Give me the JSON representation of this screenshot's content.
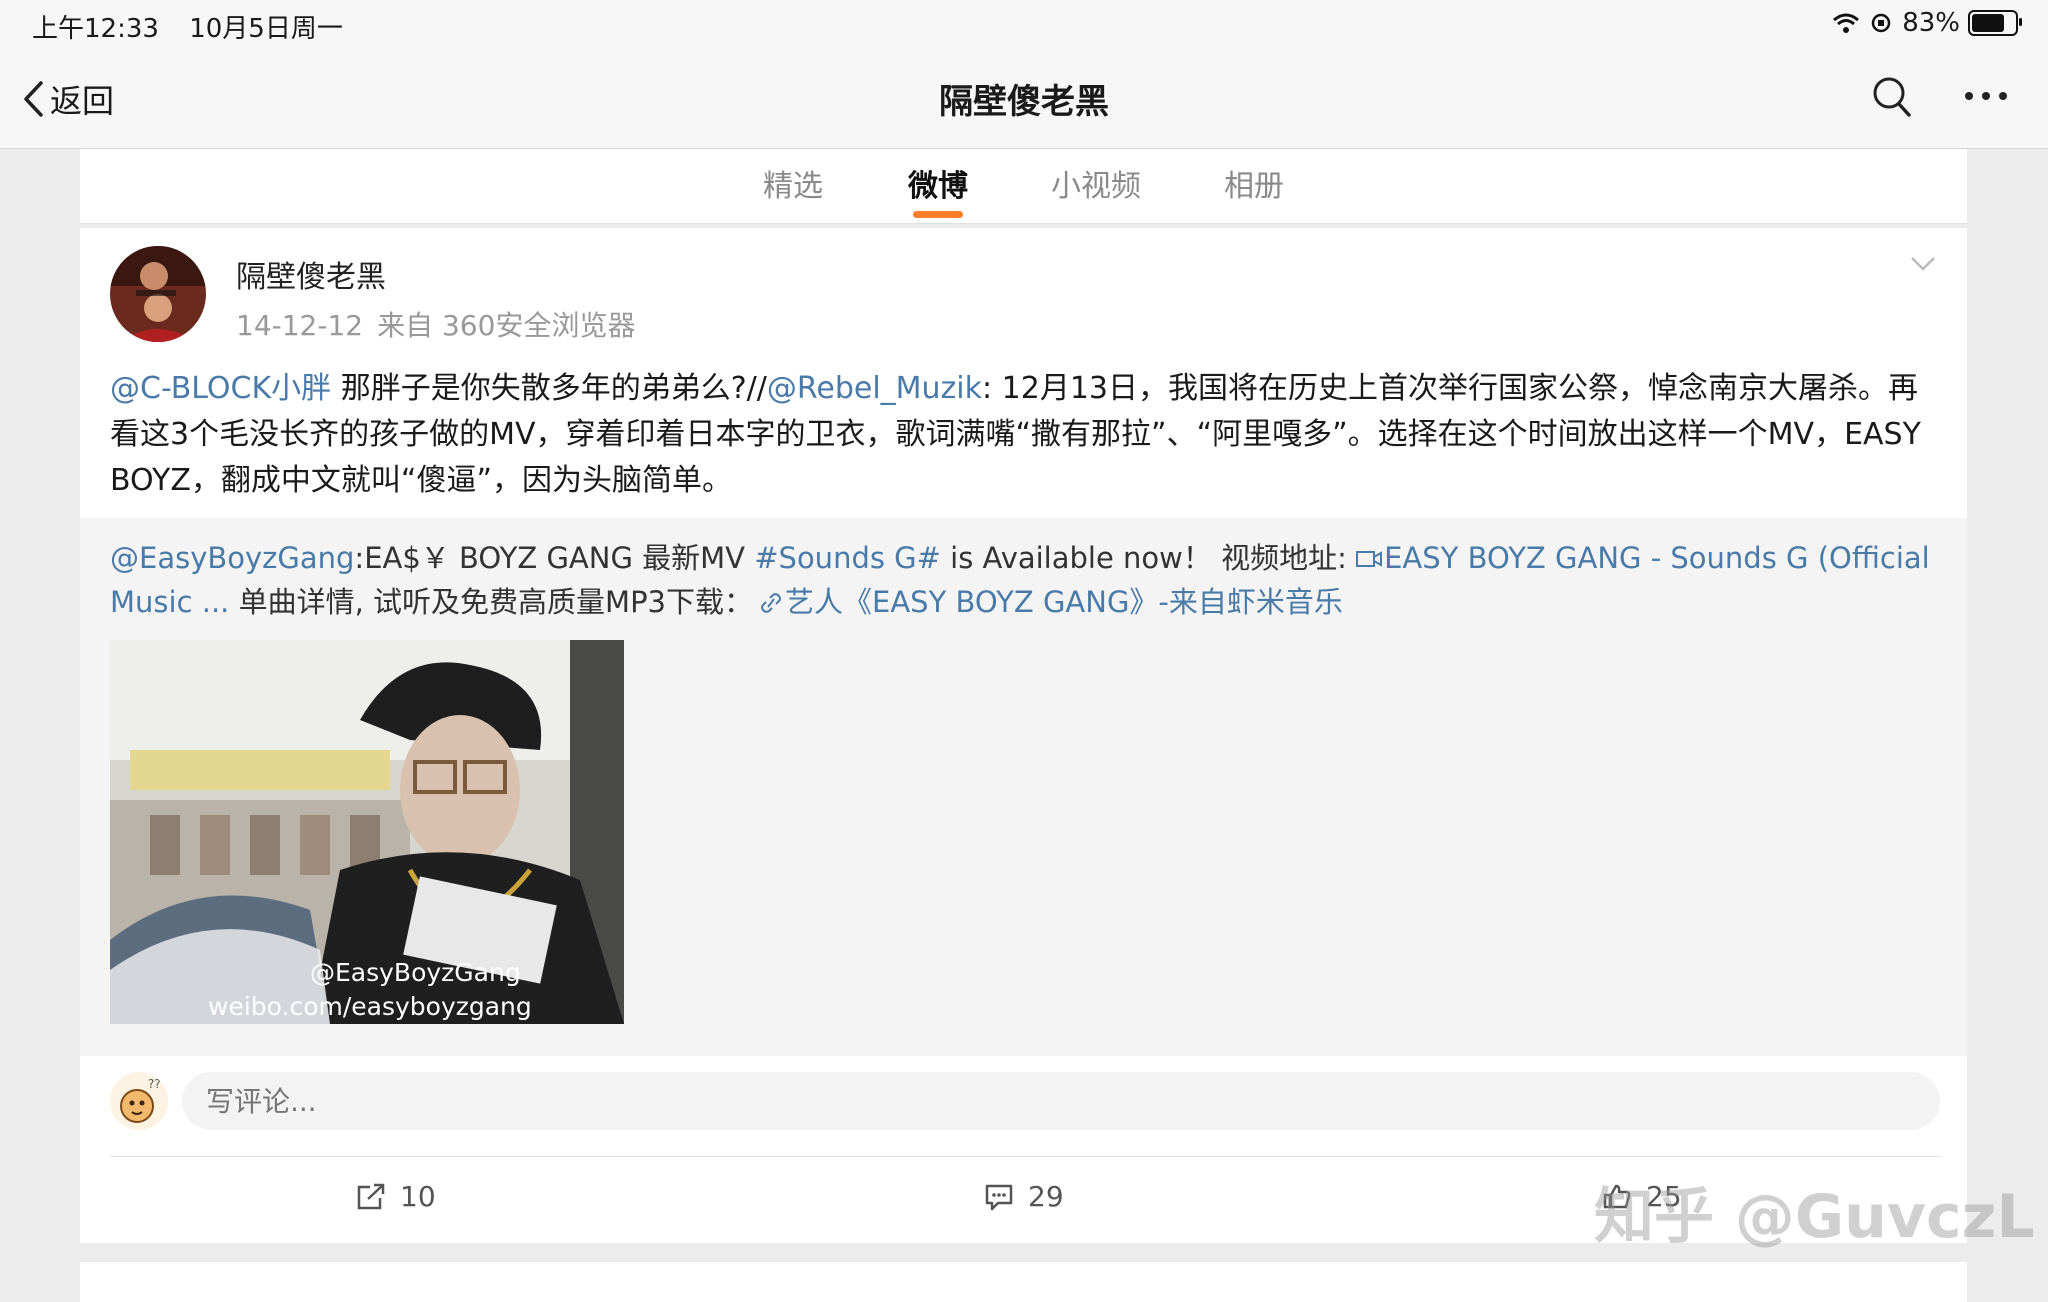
{
  "status": {
    "time": "上午12:33",
    "date": "10月5日周一",
    "battery": "83%",
    "battery_level": 0.83
  },
  "nav": {
    "back_label": "返回",
    "title": "隔壁傻老黑"
  },
  "tabs": [
    {
      "label": "精选"
    },
    {
      "label": "微博"
    },
    {
      "label": "小视频"
    },
    {
      "label": "相册"
    }
  ],
  "active_tab": "微博",
  "post": {
    "author": "隔壁傻老黑",
    "date": "14-12-12",
    "source": "来自 360安全浏览器",
    "mention1": "@C-BLOCK小胖",
    "text1": " 那胖子是你失散多年的弟弟么?//",
    "mention2": "@Rebel_Muzik",
    "text2": ": 12月13日，我国将在历史上首次举行国家公祭，悼念南京大屠杀。再看这3个毛没长齐的孩子做的MV，穿着印着日本字的卫衣，歌词满嘴“撒有那拉”、“阿里嘎多”。选择在这个时间放出这样一个MV，EASY BOYZ，翻成中文就叫“傻逼”，因为头脑简单。"
  },
  "repost": {
    "mention": "@EasyBoyzGang",
    "text1": ":EA$￥ BOYZ GANG 最新MV ",
    "hashtag": "#Sounds G#",
    "text2": " is Available now！ 视频地址: ",
    "video_link": "EASY BOYZ GANG - Sounds G (Official Music ...",
    "text3": " 单曲详情, 试听及免费高质量MP3下载：",
    "music_link": "艺人《EASY BOYZ GANG》-来自虾米音乐",
    "watermark1": "@EasyBoyzGang",
    "watermark2": "weibo.com/easyboyzgang"
  },
  "comment": {
    "placeholder": "写评论..."
  },
  "actions": {
    "repost_count": "10",
    "comment_count": "29",
    "like_count": "25"
  },
  "watermark": "知乎 @GuvczL",
  "colors": {
    "link": "#4a7aa8",
    "tab_accent": "#ff7f28"
  }
}
